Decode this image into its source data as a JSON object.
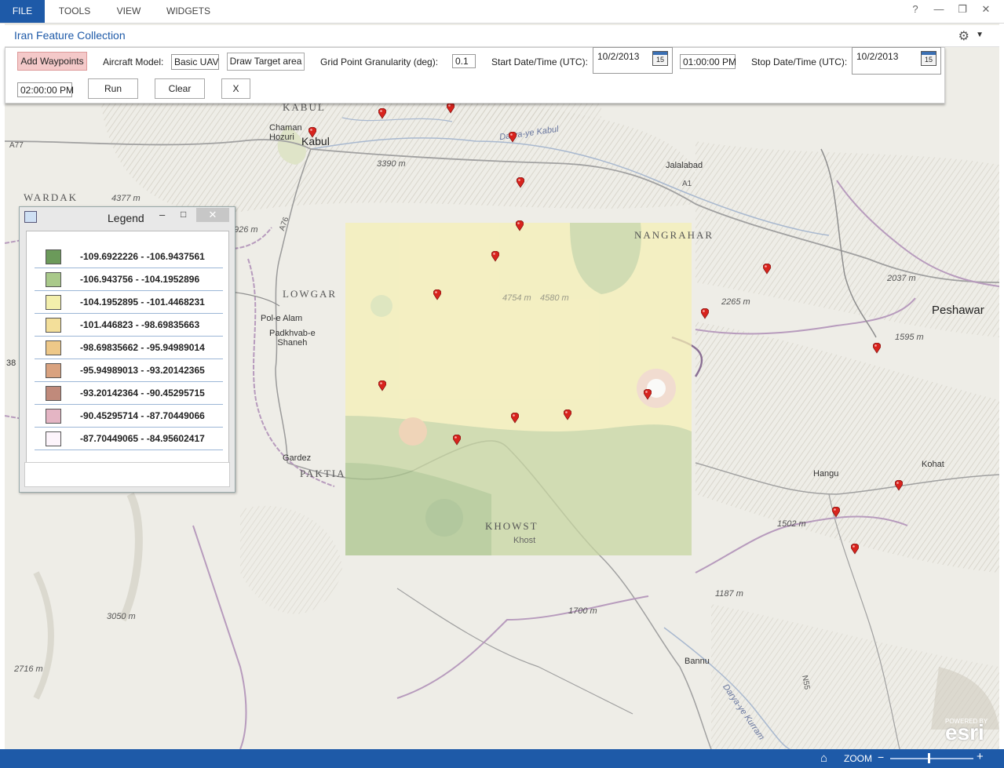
{
  "menu": {
    "items": [
      "FILE",
      "TOOLS",
      "VIEW",
      "WIDGETS"
    ]
  },
  "window_controls": {
    "help": "?",
    "minimize": "—",
    "restore": "❐",
    "close": "✕"
  },
  "panel": {
    "title": "Iran Feature Collection"
  },
  "toolbar": {
    "add_waypoints": "Add Waypoints",
    "aircraft_model_label": "Aircraft Model:",
    "aircraft_model_value": "Basic UAV",
    "draw_target_area": "Draw Target area",
    "granularity_label": "Grid Point Granularity (deg):",
    "granularity_value": "0.1",
    "start_label": "Start Date/Time (UTC):",
    "start_date": "10/2/2013",
    "start_time": "01:00:00 PM",
    "stop_label": "Stop Date/Time (UTC):",
    "stop_date": "10/2/2013",
    "stop_time": "02:00:00 PM",
    "calendar_day": "15",
    "run": "Run",
    "clear": "Clear",
    "close": "X"
  },
  "legend": {
    "title": "Legend",
    "rows": [
      {
        "label": "-109.6922226 - -106.9437561",
        "color": "#6b9a5a"
      },
      {
        "label": "-106.943756 - -104.1952896",
        "color": "#a9c98a"
      },
      {
        "label": "-104.1952895 - -101.4468231",
        "color": "#f3efac"
      },
      {
        "label": "-101.446823 - -98.69835663",
        "color": "#f3df9a"
      },
      {
        "label": "-98.69835662 - -95.94989014",
        "color": "#eec888"
      },
      {
        "label": "-95.94989013 - -93.20142365",
        "color": "#d9a27f"
      },
      {
        "label": "-93.20142364 - -90.45295715",
        "color": "#c08a7b"
      },
      {
        "label": "-90.45295714 - -87.70449066",
        "color": "#e4b5c4"
      },
      {
        "label": "-87.70449065 - -84.95602417",
        "color": "#fdf4fb"
      }
    ]
  },
  "map": {
    "labels": {
      "kabul_region": "KABUL",
      "kabul": "Kabul",
      "chaman_hozuri": "Chaman\nHozuri",
      "wardak": "WARDAK",
      "jalalabad": "Jalalabad",
      "nangrahar": "NANGRAHAR",
      "lowgar": "LOWGAR",
      "pol_e_alam": "Pol-e Alam",
      "padkhvab": "Padkhvab-e\nShaneh",
      "peshawar": "Peshawar",
      "gardez": "Gardez",
      "paktia": "PAKTIA",
      "khowst": "KHOWST",
      "khost": "Khost",
      "hangu": "Hangu",
      "kohat": "Kohat",
      "bannu": "Bannu",
      "darya_kabul": "Darya-ye Kabul",
      "darya_kurram": "Darya-ye Kurram",
      "e3390": "3390 m",
      "e4377": "4377 m",
      "e926": "926 m",
      "e4754": "4754 m",
      "e4580": "4580 m",
      "e2265": "2265 m",
      "e2037": "2037 m",
      "e1595": "1595 m",
      "e1502": "1502 m",
      "e1187": "1187 m",
      "e1700": "1700 m",
      "e3050": "3050 m",
      "e2716": "2716 m",
      "e38": "38",
      "a77": "A77",
      "a76": "A76",
      "a1": "A1",
      "n55": "N55"
    },
    "pin_color": "#d8231d"
  },
  "status": {
    "home_icon": "home-icon",
    "zoom_label": "ZOOM",
    "zoom_minus": "−",
    "zoom_plus": "+"
  },
  "attribution": "esri",
  "attribution_small": "POWERED BY"
}
